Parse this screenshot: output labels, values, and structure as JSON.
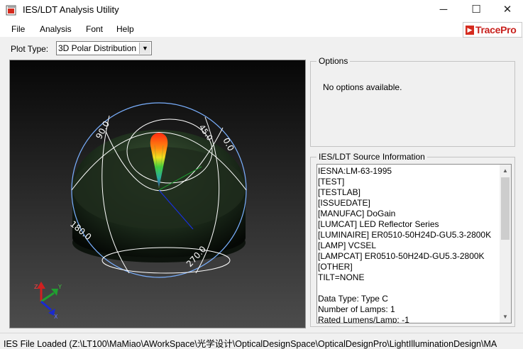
{
  "window": {
    "title": "IES/LDT Analysis Utility",
    "controls": {
      "minimize": "─",
      "maximize": "☐",
      "close": "✕"
    }
  },
  "menu": {
    "items": [
      "File",
      "Analysis",
      "Font",
      "Help"
    ]
  },
  "logo": {
    "text": "TracePro"
  },
  "toolbar": {
    "plot_type_label": "Plot Type:",
    "plot_type_value": "3D Polar Distribution"
  },
  "plot": {
    "axis_labels": [
      "90.0",
      "45.0",
      "0.0",
      "180.0",
      "270.0"
    ],
    "triad_labels": {
      "x": "X",
      "y": "Y",
      "z": "Z"
    }
  },
  "options": {
    "title": "Options",
    "message": "No options available."
  },
  "source_info": {
    "title": "IES/LDT Source Information",
    "lines": [
      "IESNA:LM-63-1995",
      "[TEST]",
      "[TESTLAB]",
      "[ISSUEDATE]",
      "[MANUFAC] DoGain",
      "[LUMCAT] LED Reflector Series",
      "[LUMINAIRE] ER0510-50H24D-GU5.3-2800K",
      "[LAMP] VCSEL",
      "[LAMPCAT] ER0510-50H24D-GU5.3-2800K",
      "[OTHER]",
      "TILT=NONE",
      "",
      "Data Type: Type C",
      "Number of Lamps: 1",
      "Rated Lumens/Lamp: -1"
    ]
  },
  "status": {
    "text": "IES File Loaded (Z:\\LT100\\MaMiao\\AWorkSpace\\光学设计\\OpticalDesignSpace\\OpticalDesignPro\\LightIlluminationDesign\\MA"
  },
  "colors": {
    "accent": "#c8201c",
    "window_bg": "#f0f0f0",
    "sphere_lines": "#ffffff",
    "outer_ring": "#7ab0ff"
  }
}
